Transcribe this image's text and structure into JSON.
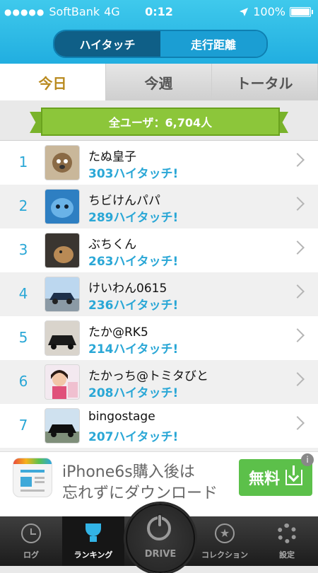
{
  "status_bar": {
    "carrier": "SoftBank",
    "network": "4G",
    "time": "0:12",
    "battery": "100%",
    "signal_dots": "●●●●●"
  },
  "segment": {
    "left_label": "ハイタッチ",
    "right_label": "走行距離"
  },
  "tabs": [
    "今日",
    "今週",
    "トータル"
  ],
  "banner": {
    "text": "全ユーザ：6,704人"
  },
  "rankings": [
    {
      "rank": "1",
      "name": "たぬ皇子",
      "count": "303ハイタッチ!"
    },
    {
      "rank": "2",
      "name": "ちビけんパパ",
      "count": "289ハイタッチ!"
    },
    {
      "rank": "3",
      "name": "ぶちくん",
      "count": "263ハイタッチ!"
    },
    {
      "rank": "4",
      "name": "けいわん0615",
      "count": "236ハイタッチ!"
    },
    {
      "rank": "5",
      "name": "たか@RK5",
      "count": "214ハイタッチ!"
    },
    {
      "rank": "6",
      "name": "たかっち@トミタびと",
      "count": "208ハイタッチ!"
    },
    {
      "rank": "7",
      "name": "bingostage",
      "count": "207ハイタッチ!"
    }
  ],
  "ad": {
    "line1": "iPhone6s購入後は",
    "line2": "忘れずにダウンロード",
    "button": "無料",
    "info": "i"
  },
  "tabbar": {
    "log": "ログ",
    "ranking": "ランキング",
    "drive": "DRIVE",
    "collection": "コレクション",
    "settings": "設定"
  }
}
